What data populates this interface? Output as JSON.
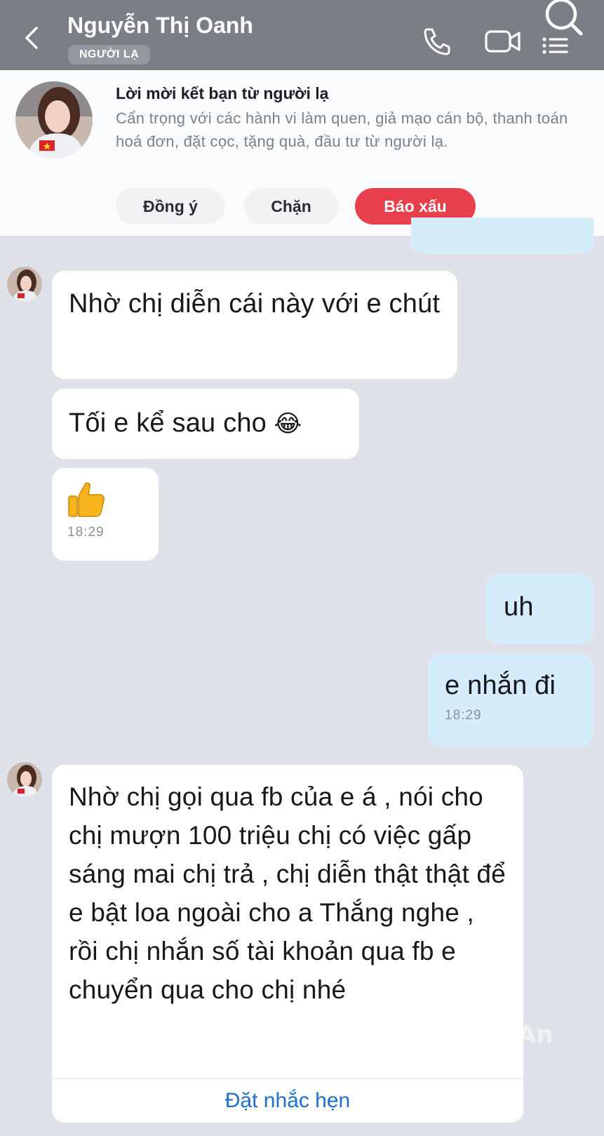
{
  "header": {
    "contact_name": "Nguyễn Thị Oanh",
    "badge": "NGƯỜI LẠ",
    "icons": [
      "chevron-left-icon",
      "phone-icon",
      "video-camera-icon",
      "search-list-icon"
    ]
  },
  "stranger_banner": {
    "title": "Lời mời kết bạn từ người lạ",
    "description": "Cẩn trọng với các hành vi làm quen, giả mạo cán bộ, thanh toán hoá đơn, đặt cọc, tặng quà, đầu tư từ người lạ.",
    "accept_label": "Đồng ý",
    "block_label": "Chặn",
    "report_label": "Báo xấu"
  },
  "messages": [
    {
      "side": "in",
      "text": "Nhờ chị diễn cái này với e chút"
    },
    {
      "side": "in",
      "text": "Tối e kể sau cho",
      "emoji": "😂"
    },
    {
      "side": "in",
      "emoji": "👍",
      "time": "18:29"
    },
    {
      "side": "out",
      "text": "uh"
    },
    {
      "side": "out",
      "text": "e nhắn đi",
      "time": "18:29"
    },
    {
      "side": "in",
      "text": "Nhờ chị gọi qua fb của e á , nói cho chị mượn 100 triệu chị có việc gấp sáng mai chị trả , chị diễn thật thật để e bật loa ngoài cho a Thắng nghe , rồi chị nhắn số tài khoản qua fb e chuyển qua cho chị nhé",
      "action": "Đặt nhắc hẹn"
    }
  ],
  "watermark": "An",
  "colors": {
    "header_bg": "#7b7e84",
    "incoming_bubble": "#ffffff",
    "outgoing_bubble": "#d5ecfa",
    "report_button": "#e5404c",
    "link": "#1c6fd1",
    "chat_bg": "#dfe2e9"
  }
}
